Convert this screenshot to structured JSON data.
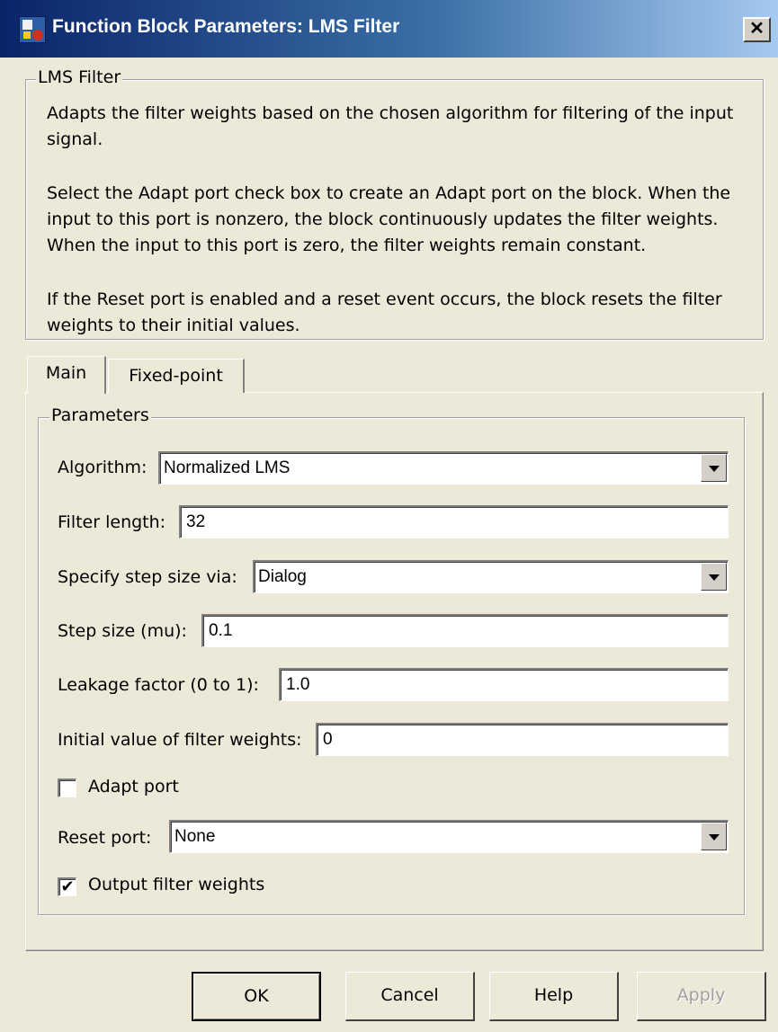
{
  "window": {
    "title": "Function Block Parameters: LMS Filter",
    "close_label": "✕"
  },
  "group_lms": {
    "legend": "LMS Filter",
    "paragraphs": [
      "Adapts the filter weights based on the chosen algorithm for filtering of the input signal.",
      "Select the Adapt port check box to create an Adapt port on the block. When the input to this port is nonzero, the block continuously updates the filter weights. When the input to this port is zero, the filter weights remain constant.",
      "If the Reset port is enabled and a reset event occurs, the block resets the filter weights to their initial values."
    ]
  },
  "tabs": [
    {
      "label": "Main",
      "active": true
    },
    {
      "label": "Fixed-point",
      "active": false
    }
  ],
  "parameters": {
    "legend": "Parameters",
    "algorithm": {
      "label": "Algorithm:",
      "value": "Normalized LMS"
    },
    "filter_length": {
      "label": "Filter length:",
      "value": "32"
    },
    "step_size_via": {
      "label": "Specify step size via:",
      "value": "Dialog"
    },
    "step_size": {
      "label": "Step size (mu):",
      "value": "0.1"
    },
    "leakage": {
      "label": "Leakage factor (0 to 1):",
      "value": "1.0"
    },
    "initial_weights": {
      "label": "Initial value of filter weights:",
      "value": "0"
    },
    "adapt_port": {
      "label": "Adapt port",
      "checked": false
    },
    "reset_port": {
      "label": "Reset port:",
      "value": "None"
    },
    "output_weights": {
      "label": "Output filter weights",
      "checked": true,
      "mark": "✔"
    }
  },
  "buttons": {
    "ok": "OK",
    "cancel": "Cancel",
    "help": "Help",
    "apply": "Apply"
  }
}
